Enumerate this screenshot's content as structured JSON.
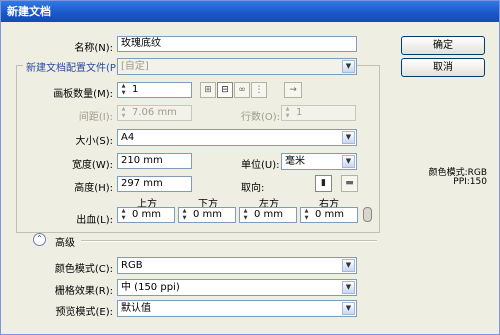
{
  "window": {
    "title": "新建文档"
  },
  "name": {
    "label": "名称(N):",
    "value": "玫瑰底纹"
  },
  "profile": {
    "label": "新建文档配置文件(P):",
    "value": "[自定]"
  },
  "artboards": {
    "label": "画板数量(M):",
    "value": "1"
  },
  "spacing": {
    "label": "间距(I):",
    "value": "7.06 mm"
  },
  "columns": {
    "label": "行数(O):",
    "value": "1"
  },
  "size": {
    "label": "大小(S):",
    "value": "A4"
  },
  "width": {
    "label": "宽度(W):",
    "value": "210 mm"
  },
  "units": {
    "label": "单位(U):",
    "value": "毫米"
  },
  "height": {
    "label": "高度(H):",
    "value": "297 mm"
  },
  "orientation": {
    "label": "取向:"
  },
  "bleed": {
    "label": "出血(L):",
    "top_label": "上方",
    "top_value": "0 mm",
    "bottom_label": "下方",
    "bottom_value": "0 mm",
    "left_label": "左方",
    "left_value": "0 mm",
    "right_label": "右方",
    "right_value": "0 mm"
  },
  "advanced": {
    "label": "高级"
  },
  "color_mode": {
    "label": "颜色模式(C):",
    "value": "RGB"
  },
  "raster": {
    "label": "栅格效果(R):",
    "value": "中 (150 ppi)"
  },
  "preview": {
    "label": "预览模式(E):",
    "value": "默认值"
  },
  "buttons": {
    "ok": "确定",
    "cancel": "取消"
  },
  "info": {
    "color_mode": "颜色模式:RGB",
    "ppi": "PPI:150"
  },
  "icons": {
    "spinner": "spinner-icon",
    "dropdown": "chevron-down-icon",
    "link": "chain-link-icon"
  },
  "colors": {
    "title_bar": "#1a56c8",
    "window_bg": "#efeee3",
    "section_title": "#2a4ba0"
  }
}
